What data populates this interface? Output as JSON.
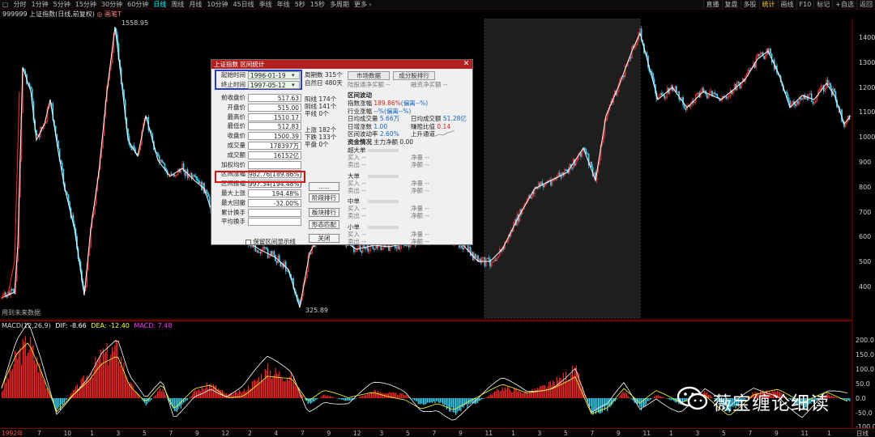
{
  "toolbar": {
    "left": [
      "▢",
      "分时",
      "1分钟",
      "5分钟",
      "15分钟",
      "30分钟",
      "60分钟",
      "日线",
      "周线",
      "月线",
      "10分钟",
      "45日线",
      "季线",
      "年线",
      "5秒",
      "15秒",
      "多周期",
      "更多 ›"
    ],
    "active_index": 7,
    "right": [
      "直播",
      "复盘",
      "多股",
      "统计",
      "画线",
      "F10",
      "标记",
      "+自选",
      "返回"
    ],
    "highlight_index": 3
  },
  "infoline": {
    "code": "999999",
    "name": "上证指数(日线,前复权)",
    "extra": "◎ 画笔T"
  },
  "price_axis": [
    "1400",
    "1300",
    "1200",
    "1100",
    "1000",
    "900",
    "800",
    "700",
    "600",
    "500",
    "400"
  ],
  "annotations": {
    "high": "1558.95",
    "low": "325.89",
    "future": "用到未来数据"
  },
  "macd": {
    "label": "MACD(12,26,9)",
    "dif": "DIF: -8.66",
    "dea": "DEA: -12.40",
    "macd": "MACD: 7.48"
  },
  "macd_axis": [
    "200.0",
    "150.0",
    "100.0",
    "50.0",
    "0.0",
    "-50.0",
    "-100.0"
  ],
  "x_axis": {
    "first": "1992年",
    "ticks": [
      "7",
      "10",
      "1",
      "3",
      "5",
      "7",
      "9",
      "12",
      "2",
      "4",
      "7",
      "9",
      "12",
      "3",
      "5",
      "7",
      "9",
      "11",
      "1",
      "3",
      "5",
      "7",
      "9",
      "11",
      "1",
      "3",
      "5",
      "7",
      "9",
      "11",
      "1"
    ],
    "right": "日线"
  },
  "dialog": {
    "title": "上证指数 区间统计",
    "start_label": "起始时间",
    "start": "1996-01-19",
    "end_label": "终止时间",
    "end": "1997-05-12",
    "fields": [
      {
        "label": "前收盘价",
        "value": "517.63"
      },
      {
        "label": "开盘价",
        "value": "515.00"
      },
      {
        "label": "最高价",
        "value": "1510.17"
      },
      {
        "label": "最低价",
        "value": "512.83"
      },
      {
        "label": "收盘价",
        "value": "1500.39"
      },
      {
        "label": "成交量",
        "value": "178397万"
      },
      {
        "label": "成交额",
        "value": "16152亿"
      },
      {
        "label": "加权均价",
        "value": ""
      },
      {
        "label": "区间涨幅",
        "value": "982.76(189.86%)"
      },
      {
        "label": "区间振幅",
        "value": "997.34(194.48%)"
      },
      {
        "label": "最大上涨",
        "value": "194.48%"
      },
      {
        "label": "最大回撤",
        "value": "-32.00%"
      },
      {
        "label": "累计换手",
        "value": ""
      },
      {
        "label": "平均换手",
        "value": ""
      }
    ],
    "checkbox": "保留区间显示线",
    "mid": [
      "周期数 315个",
      "自然日 480天",
      "阳线 174个",
      "阴线 141个",
      "平线 0个",
      "上涨 182个",
      "下跌 133个",
      "平盘 0个"
    ],
    "buttons": [
      "......",
      "阶段排行",
      "板块排行",
      "形态匹配",
      "关闭"
    ],
    "tabs": [
      "市场数据",
      "成分股排行"
    ],
    "inflow": "陆股通净买额 --",
    "inflow2": "融资净买额 --",
    "range_title": "区间波动",
    "range": [
      {
        "k": "指数涨幅",
        "v": "189.86%",
        "s": "(偏离--%)"
      },
      {
        "k": "行业涨幅",
        "v": "--%",
        "s": "(偏离--%)"
      },
      {
        "k": "日均成交量",
        "v": "5.66万",
        "k2": "日均成交额",
        "v2": "51.28亿"
      },
      {
        "k": "日增涨数",
        "v": "1.00",
        "k2": "赚赔比值",
        "v2": "0.14"
      },
      {
        "k": "区间波动率",
        "v": "2.60%",
        "k2": "上升通道",
        "v2": ""
      }
    ],
    "fund_title": "资金情况",
    "fund_sub": "主力净额 0.00",
    "groups": [
      {
        "name": "超大单",
        "buy": "买入 --",
        "net": "净量 --",
        "sell": "卖出 --",
        "amt": "净额 --"
      },
      {
        "name": "大单",
        "buy": "买入 --",
        "net": "净量 --",
        "sell": "卖出 --",
        "amt": "净额 --"
      },
      {
        "name": "中单",
        "buy": "买入 --",
        "net": "净量 --",
        "sell": "卖出 --",
        "amt": "净额 --"
      },
      {
        "name": "小单",
        "buy": "买入 --",
        "net": "净量 --",
        "sell": "卖出 --",
        "amt": "净额 --"
      }
    ]
  },
  "watermark": "薇宝缠论细读"
}
